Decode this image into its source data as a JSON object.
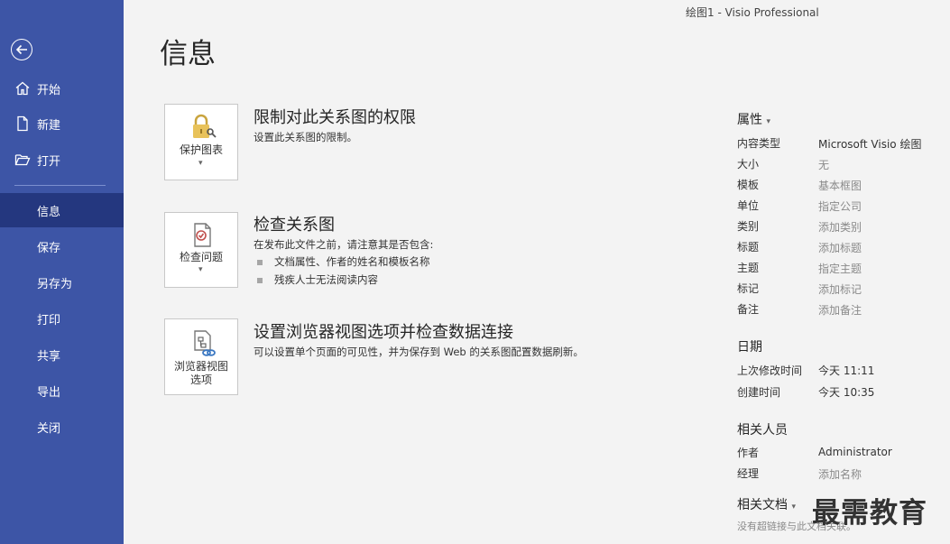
{
  "app_title": "绘图1  -  Visio Professional",
  "page_title": "信息",
  "sidebar": {
    "items": [
      {
        "label": "开始",
        "icon": "home-icon"
      },
      {
        "label": "新建",
        "icon": "new-document-icon"
      },
      {
        "label": "打开",
        "icon": "open-folder-icon"
      },
      {
        "label": "信息"
      },
      {
        "label": "保存"
      },
      {
        "label": "另存为"
      },
      {
        "label": "打印"
      },
      {
        "label": "共享"
      },
      {
        "label": "导出"
      },
      {
        "label": "关闭"
      }
    ],
    "active": "信息"
  },
  "sections": {
    "protect": {
      "button_label": "保护图表",
      "heading": "限制对此关系图的权限",
      "description": "设置此关系图的限制。"
    },
    "inspect": {
      "button_label": "检查问题",
      "heading": "检查关系图",
      "description": "在发布此文件之前，请注意其是否包含:",
      "bullets": [
        "文档属性、作者的姓名和模板名称",
        "残疾人士无法阅读内容"
      ]
    },
    "browser": {
      "button_label": "浏览器视图选项",
      "heading": "设置浏览器视图选项并检查数据连接",
      "description": "可以设置单个页面的可见性，并为保存到 Web 的关系图配置数据刷新。"
    }
  },
  "properties": {
    "heading": "属性",
    "rows": [
      {
        "key": "内容类型",
        "value": "Microsoft Visio 绘图"
      },
      {
        "key": "大小",
        "value": "无"
      },
      {
        "key": "模板",
        "value": "基本框图"
      },
      {
        "key": "单位",
        "value": "指定公司"
      },
      {
        "key": "类别",
        "value": "添加类别"
      },
      {
        "key": "标题",
        "value": "添加标题"
      },
      {
        "key": "主题",
        "value": "指定主题"
      },
      {
        "key": "标记",
        "value": "添加标记"
      },
      {
        "key": "备注",
        "value": "添加备注"
      }
    ]
  },
  "dates": {
    "heading": "日期",
    "rows": [
      {
        "key": "上次修改时间",
        "value": "今天 11:11"
      },
      {
        "key": "创建时间",
        "value": "今天 10:35"
      }
    ]
  },
  "people": {
    "heading": "相关人员",
    "rows": [
      {
        "key": "作者",
        "value": "Administrator"
      },
      {
        "key": "经理",
        "value": "添加名称"
      }
    ]
  },
  "related_docs": {
    "heading": "相关文档",
    "note": "没有超链接与此文档关联。"
  },
  "watermark": "最需教育",
  "colors": {
    "sidebar": "#3d55a6",
    "sidebar_active": "#24377f",
    "background": "#f3f3f3"
  }
}
